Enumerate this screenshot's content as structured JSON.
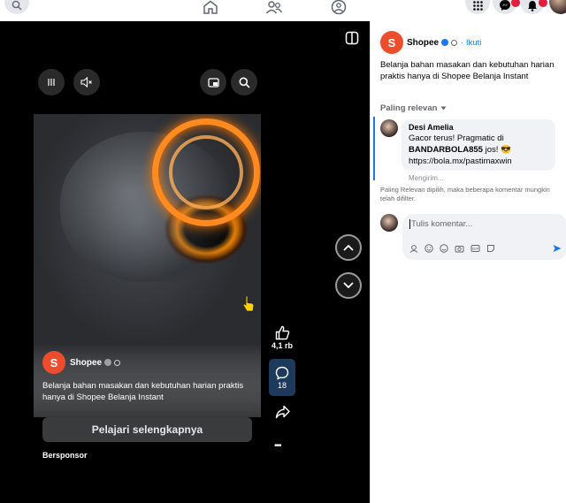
{
  "topbar": {
    "search_icon": "search-icon",
    "nav_icons": [
      "home-icon",
      "friends-icon",
      "groups-icon"
    ],
    "right_icons": [
      "menu-grid-icon",
      "messenger-icon",
      "notifications-icon",
      "profile-avatar"
    ]
  },
  "video": {
    "page_name": "Shopee",
    "caption": "Belanja bahan masakan dan kebutuhan harian praktis hanya di Shopee Belanja Instant",
    "cta_label": "Pelajari selengkapnya",
    "sponsored_label": "Bersponsor",
    "likes_count": "4,1 rb",
    "comments_count": "18",
    "more_label": "•••"
  },
  "post": {
    "page_name": "Shopee",
    "follow_label": "· Ikuti",
    "caption": "Belanja bahan masakan dan kebutuhan harian praktis hanya di Shopee Belanja Instant"
  },
  "comments": {
    "sort_label": "Paling relevan",
    "items": [
      {
        "author": "Desi Amelia",
        "line1": "Gacor terus! Pragmatic di",
        "line2_bold": "BANDARBOLA855",
        "line2_rest": " jos! 😎",
        "line3": "https://bola.mx/pastimaxwin",
        "status": "Mengirim..."
      }
    ],
    "note": "Paling Relevan dipilih, maka beberapa komentar mungkin telah difilter.",
    "input_placeholder": "Tulis komentar..."
  },
  "colors": {
    "shopee": "#ee4d2d",
    "verified": "#1877f2",
    "accent_ring": "#ff8a1f",
    "comment_bg": "#f0f2f5",
    "comment_active": "#1d3a5c"
  }
}
